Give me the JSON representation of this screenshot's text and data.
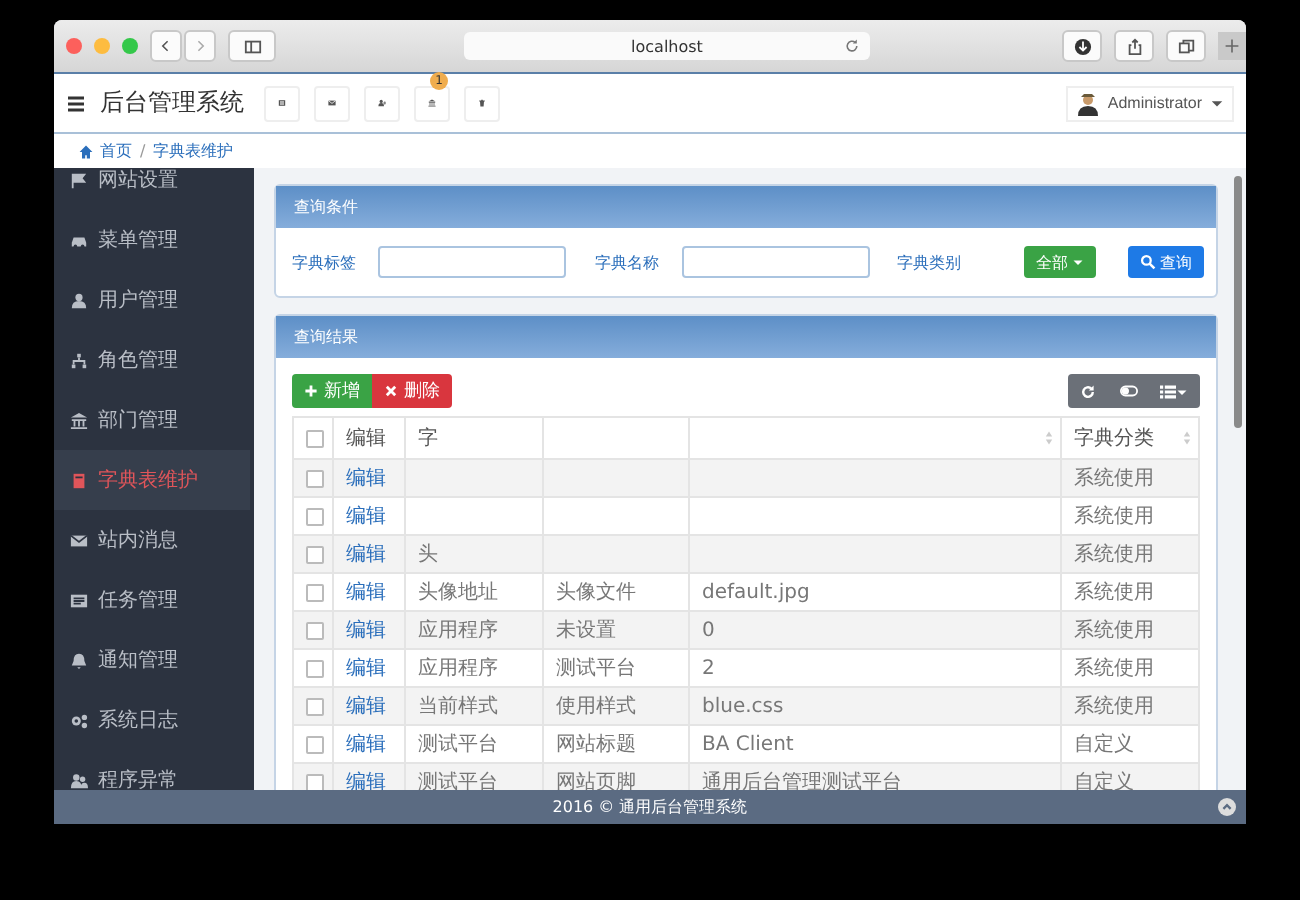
{
  "browser": {
    "url": "localhost"
  },
  "app": {
    "title": "后台管理系统",
    "badge": "1",
    "user": "Administrator"
  },
  "breadcrumb": [
    "首页",
    "/",
    "字典表维护"
  ],
  "sidebar": {
    "items": [
      {
        "label": "网站设置",
        "selected": false
      },
      {
        "label": "菜单管理",
        "selected": false
      },
      {
        "label": "用户管理",
        "selected": false
      },
      {
        "label": "角色管理",
        "selected": false
      },
      {
        "label": "部门管理",
        "selected": false
      },
      {
        "label": "字典表维护",
        "selected": true
      },
      {
        "label": "站内消息",
        "selected": false
      },
      {
        "label": "任务管理",
        "selected": false
      },
      {
        "label": "通知管理",
        "selected": false
      },
      {
        "label": "系统日志",
        "selected": false
      },
      {
        "label": "程序异常",
        "selected": false
      }
    ]
  },
  "query_panel": {
    "title": "查询条件",
    "fields": [
      {
        "label": "字典标签"
      },
      {
        "label": "字典名称"
      }
    ],
    "category_label": "字典类别",
    "category_dropdown": "全部",
    "search_button": "查询"
  },
  "results_panel": {
    "title": "查询结果",
    "buttons": [
      "新增",
      "删除"
    ],
    "table": {
      "header_checkbox": {
        "checked": false
      },
      "columns": [
        {
          "label": "编辑",
          "sortable": false
        },
        {
          "label": "字",
          "sortable": false
        },
        {
          "sortable": false
        },
        {
          "sortable": true
        },
        {
          "label": "字典分类",
          "sortable": true
        }
      ],
      "rows": [
        {
          "checked": false,
          "cells": [
            "编辑",
            null,
            null,
            null,
            "系统使用"
          ]
        },
        {
          "checked": false,
          "cells": [
            "编辑",
            null,
            null,
            null,
            "系统使用"
          ]
        },
        {
          "checked": false,
          "cells": [
            "编辑",
            "头",
            null,
            null,
            "系统使用"
          ]
        },
        {
          "checked": false,
          "cells": [
            "编辑",
            "头像地址",
            "头像文件",
            "default.jpg",
            "系统使用"
          ]
        },
        {
          "checked": false,
          "cells": [
            "编辑",
            "应用程序",
            "未设置",
            "0",
            "系统使用"
          ]
        },
        {
          "checked": false,
          "cells": [
            "编辑",
            "应用程序",
            "测试平台",
            "2",
            "系统使用"
          ]
        },
        {
          "checked": false,
          "cells": [
            "编辑",
            "当前样式",
            "使用样式",
            "blue.css",
            "系统使用"
          ]
        },
        {
          "checked": false,
          "cells": [
            "编辑",
            "测试平台",
            "网站标题",
            "BA Client",
            "自定义"
          ]
        },
        {
          "checked": false,
          "cells": [
            "编辑",
            "测试平台",
            "网站页脚",
            "通用后台管理测试平台",
            "自定义"
          ]
        }
      ]
    }
  },
  "footer": "2016 © 通用后台管理系统"
}
